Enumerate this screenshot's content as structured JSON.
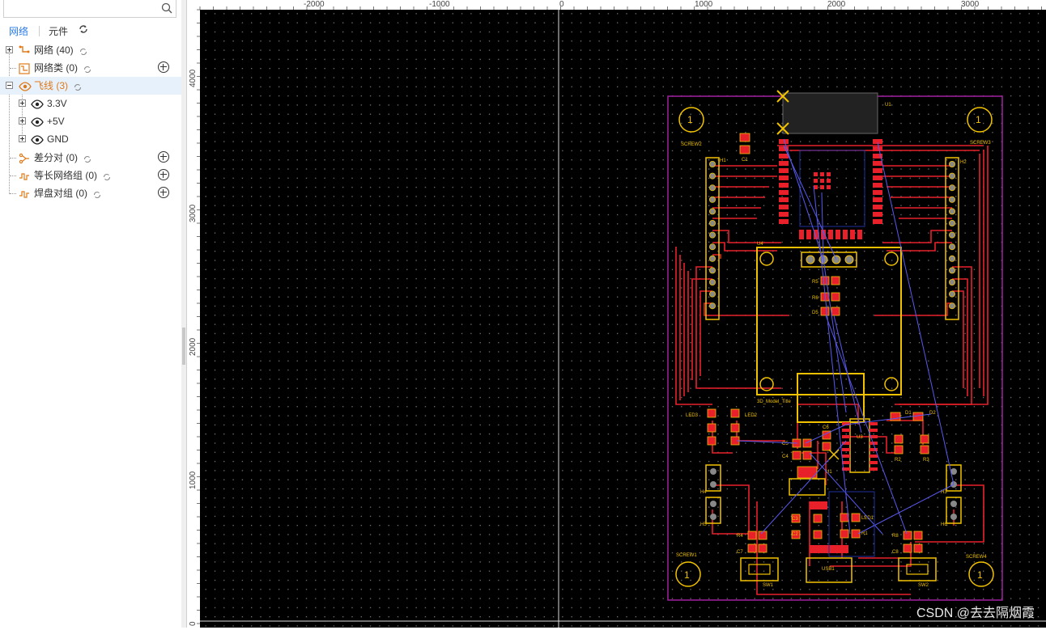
{
  "panel": {
    "search": {
      "value": "",
      "placeholder": ""
    },
    "tabs": [
      {
        "label": "网络"
      },
      {
        "label": "元件"
      }
    ],
    "tree": {
      "nets": {
        "label": "网络 (40)"
      },
      "netclasses": {
        "label": "网络类 (0)"
      },
      "ratlines": {
        "label": "飞线 (3)",
        "children": [
          {
            "label": "3.3V"
          },
          {
            "label": "+5V"
          },
          {
            "label": "GND"
          }
        ]
      },
      "diffpairs": {
        "label": "差分对 (0)"
      },
      "equal_length": {
        "label": "等长网络组 (0)"
      },
      "pad_pairs": {
        "label": "焊盘对组 (0)"
      }
    }
  },
  "ruler": {
    "x_labels": [
      "-2000",
      "-1000",
      "0",
      "1000",
      "2000",
      "3000"
    ],
    "y_labels": [
      "4000",
      "3000",
      "2000",
      "1000",
      "0"
    ]
  },
  "pcb": {
    "designators": [
      "1",
      "SCREW2",
      "1",
      "SCREW3",
      "C1",
      "U4",
      "H1",
      "H2",
      "R5",
      "R6",
      "D5",
      "3D_Model_Title",
      "LED3",
      "LED2",
      "C6",
      "C5",
      "C4",
      "U3",
      "R2",
      "R3",
      "D1",
      "D2",
      "H4",
      "H5",
      "H3",
      "H6",
      "U1",
      "C3",
      "C2",
      "LED1",
      "R1",
      "R4",
      "R8",
      "C7",
      "C8",
      "SW1",
      "SW2",
      "USB1",
      "SCREW1",
      "SCREW4",
      "1",
      "1"
    ],
    "colors": {
      "board": "#000000",
      "track": "#e8202a",
      "silk": "#f2c200",
      "outline": "#a020a0",
      "ratline": "#5a5af0",
      "grid": "#777777"
    }
  },
  "watermark": "CSDN @去去隔烟霞"
}
